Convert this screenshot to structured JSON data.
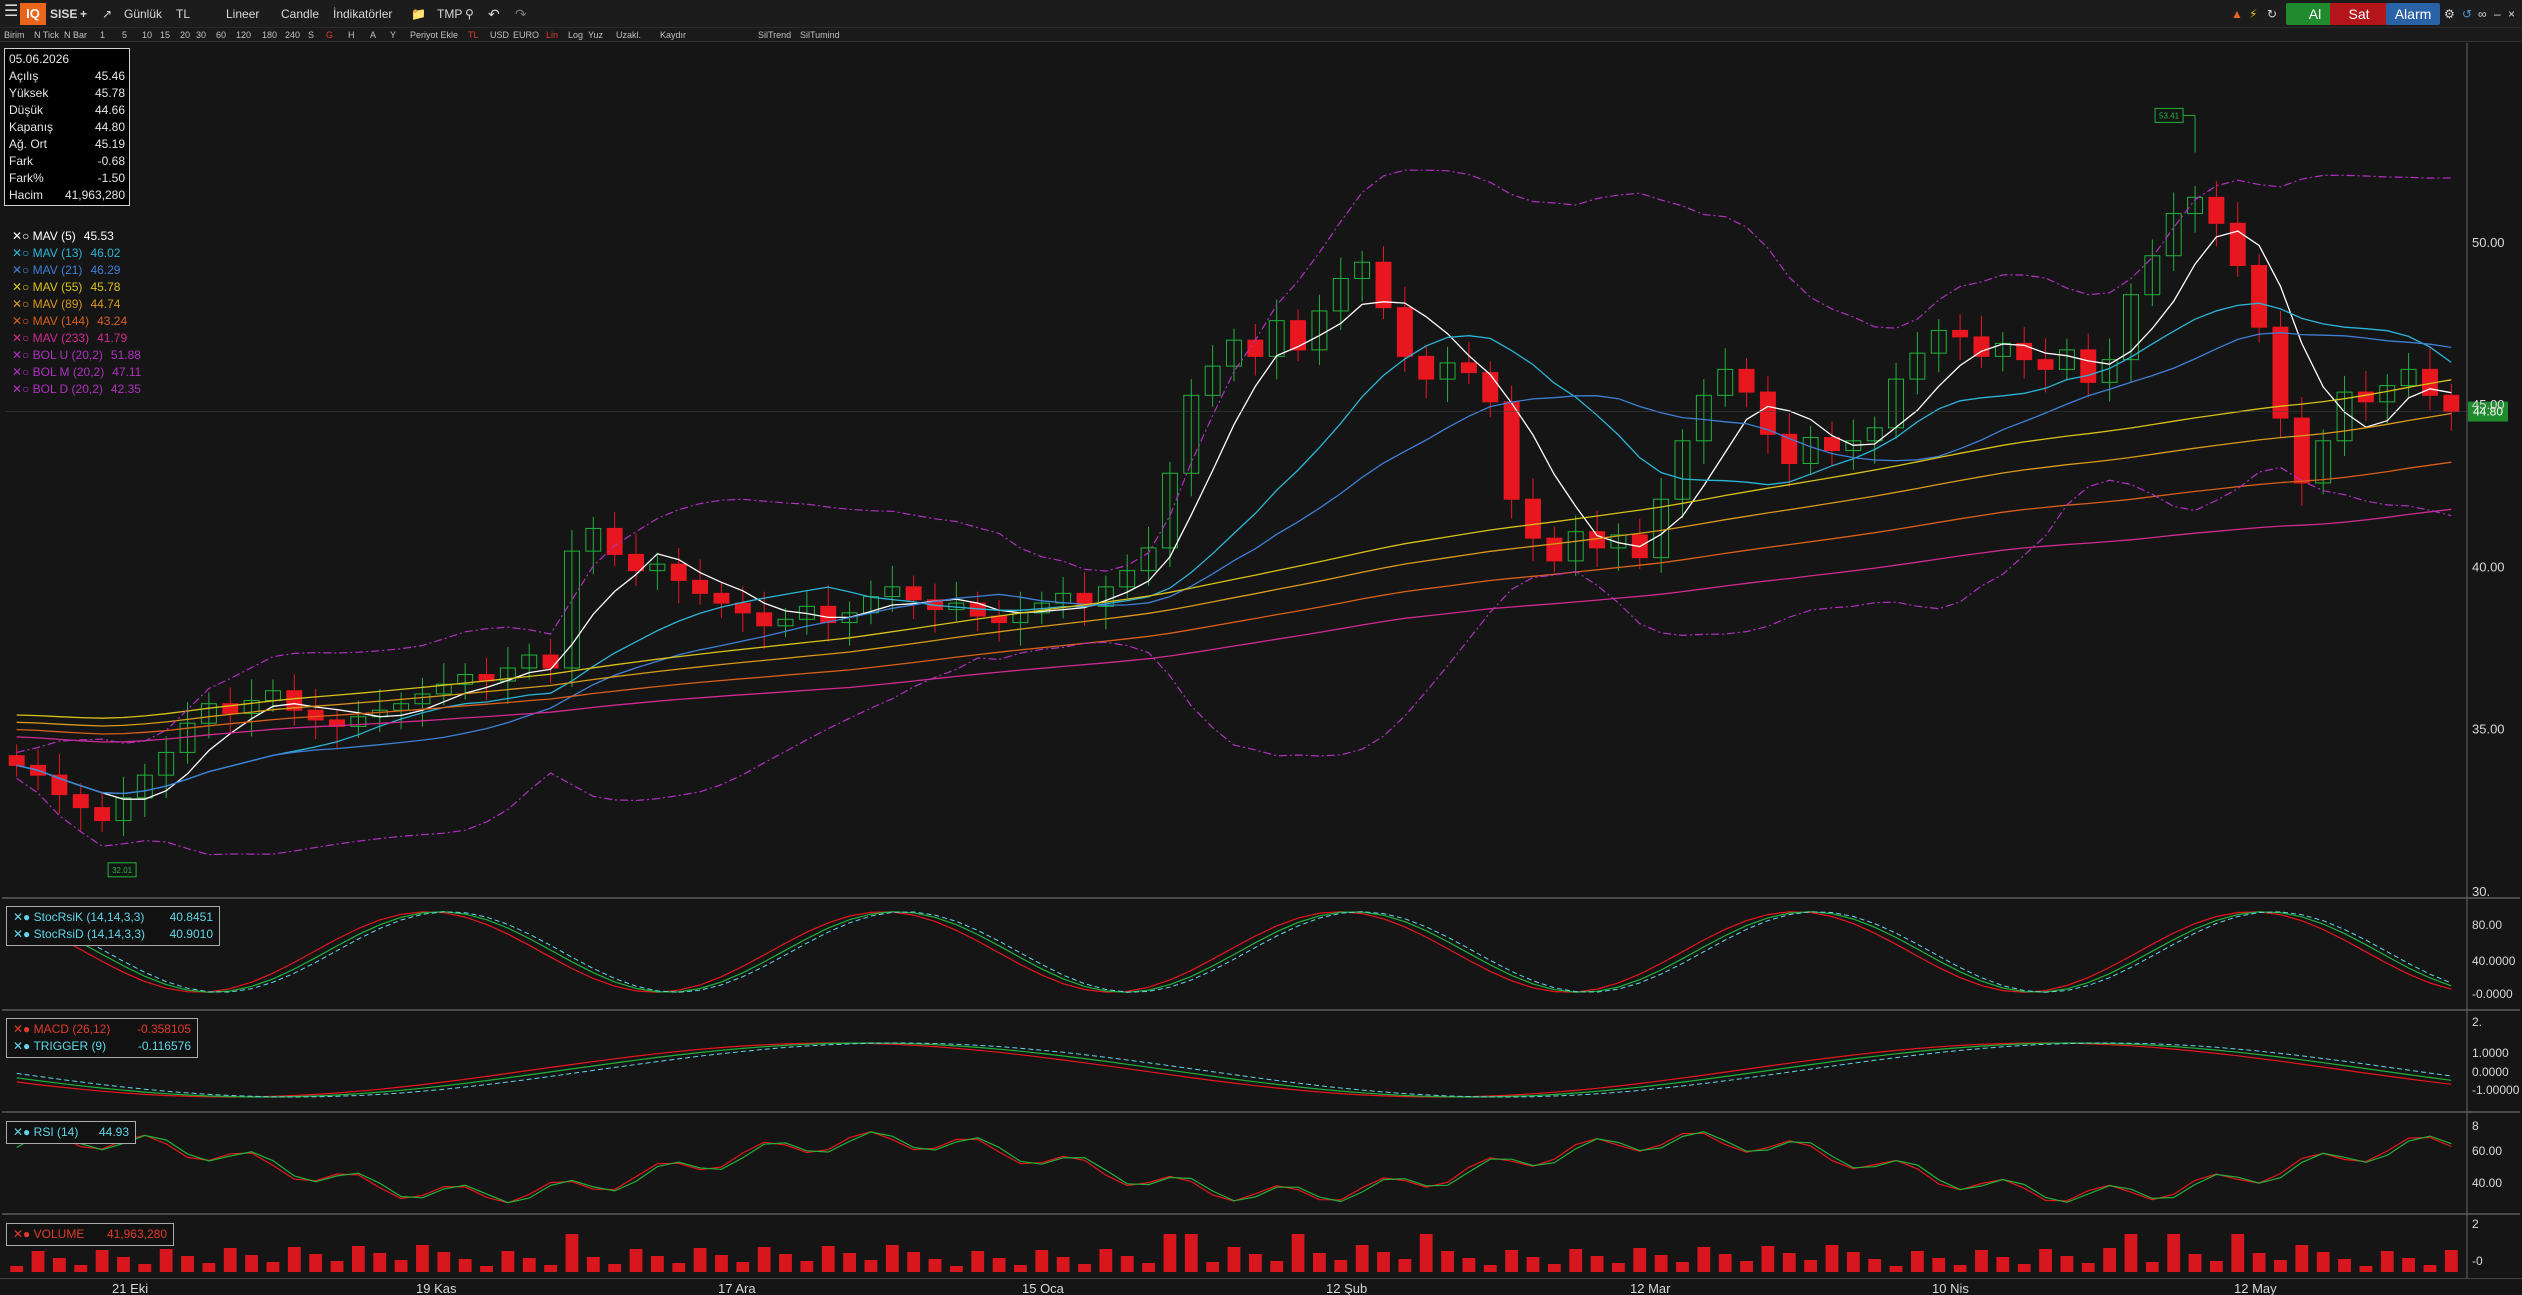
{
  "toolbar": {
    "logo": "IQ",
    "symbol": "SISE",
    "add": "+",
    "period": "Günlük",
    "currency": "TL",
    "scale": "Lineer",
    "chart_type": "Candle",
    "indicators": "İndikatörler",
    "tmp": "TMP",
    "buy": "Al",
    "sell": "Sat",
    "alarm": "Alarm"
  },
  "subbar": {
    "items": [
      "Birim",
      "N Tick",
      "N Bar",
      "1",
      "5",
      "10",
      "15",
      "20",
      "30",
      "60",
      "120",
      "180",
      "240",
      "S",
      "G",
      "H",
      "A",
      "Y",
      "Periyot Ekle",
      "TL",
      "USD",
      "EURO",
      "Lin",
      "Log",
      "Yuz",
      "Uzakl.",
      "Kaydır",
      "SilTrend",
      "SilTumind"
    ]
  },
  "info_box": {
    "date": "05.06.2026",
    "rows": [
      {
        "label": "Açılış",
        "value": "45.46"
      },
      {
        "label": "Yüksek",
        "value": "45.78"
      },
      {
        "label": "Düşük",
        "value": "44.66"
      },
      {
        "label": "Kapanış",
        "value": "44.80"
      },
      {
        "label": "Ağ. Ort",
        "value": "45.19"
      },
      {
        "label": "Fark",
        "value": "-0.68"
      },
      {
        "label": "Fark%",
        "value": "-1.50"
      },
      {
        "label": "Hacim",
        "value": "41,963,280"
      }
    ]
  },
  "legend": [
    {
      "label": "MAV (5)",
      "value": "45.53",
      "color": "#ffffff"
    },
    {
      "label": "MAV (13)",
      "value": "46.02",
      "color": "#2bb5d6"
    },
    {
      "label": "MAV (21)",
      "value": "46.29",
      "color": "#3f7fd6"
    },
    {
      "label": "MAV (55)",
      "value": "45.78",
      "color": "#d8c21a"
    },
    {
      "label": "MAV (89)",
      "value": "44.74",
      "color": "#d89a1a"
    },
    {
      "label": "MAV (144)",
      "value": "43.24",
      "color": "#d8601a"
    },
    {
      "label": "MAV (233)",
      "value": "41.79",
      "color": "#d02a90"
    },
    {
      "label": "BOL U (20,2)",
      "value": "51.88",
      "color": "#b030c0"
    },
    {
      "label": "BOL M (20,2)",
      "value": "47.11",
      "color": "#b030c0"
    },
    {
      "label": "BOL D (20,2)",
      "value": "42.35",
      "color": "#b030c0"
    }
  ],
  "price_axis": {
    "labels": [
      "50.00",
      "45.00",
      "40.00",
      "35.00",
      "30."
    ],
    "last_price": "44.80",
    "hi_marker": "53.41",
    "lo_marker": "32.01"
  },
  "stoch": {
    "k_label": "StocRsiK (14,14,3,3)",
    "k_value": "40.8451",
    "d_label": "StocRsiD (14,14,3,3)",
    "d_value": "40.9010",
    "axis": [
      "80.00",
      "40.0000",
      "-0.0000"
    ]
  },
  "macd": {
    "macd_label": "MACD (26,12)",
    "macd_value": "-0.358105",
    "trig_label": "TRIGGER (9)",
    "trig_value": "-0.116576",
    "axis": [
      "2.",
      "1.0000",
      "0.0000",
      "-1.00000"
    ]
  },
  "rsi": {
    "label": "RSI (14)",
    "value": "44.93",
    "axis": [
      "8",
      "60.00",
      "40.00"
    ]
  },
  "volume": {
    "label": "VOLUME",
    "value": "41,963,280",
    "axis": [
      "2",
      "-0"
    ]
  },
  "dates": [
    "21 Eki",
    "19 Kas",
    "17 Ara",
    "15 Oca",
    "12 Şub",
    "12 Mar",
    "10 Nis",
    "12 May"
  ],
  "chart_data": {
    "type": "candlestick",
    "symbol": "SISE",
    "ylim": [
      30,
      56
    ],
    "closes": [
      33.9,
      33.6,
      33.0,
      32.6,
      32.2,
      32.9,
      33.6,
      34.3,
      35.2,
      35.8,
      35.5,
      35.9,
      36.2,
      35.6,
      35.3,
      35.1,
      35.4,
      35.6,
      35.8,
      36.1,
      36.4,
      36.7,
      36.5,
      36.9,
      37.3,
      36.9,
      40.5,
      41.2,
      40.4,
      39.9,
      40.1,
      39.6,
      39.2,
      38.9,
      38.6,
      38.2,
      38.4,
      38.8,
      38.3,
      38.6,
      39.1,
      39.4,
      39.0,
      38.7,
      38.9,
      38.5,
      38.3,
      38.6,
      38.9,
      39.2,
      38.8,
      39.4,
      39.9,
      40.6,
      42.9,
      45.3,
      46.2,
      47.0,
      46.5,
      47.6,
      46.7,
      47.9,
      48.9,
      49.4,
      48.0,
      46.5,
      45.8,
      46.3,
      46.0,
      45.1,
      42.1,
      40.9,
      40.2,
      41.1,
      40.6,
      41.0,
      40.3,
      42.1,
      43.9,
      45.3,
      46.1,
      45.4,
      44.1,
      43.2,
      44.0,
      43.6,
      43.9,
      44.3,
      45.8,
      46.6,
      47.3,
      47.1,
      46.5,
      46.9,
      46.4,
      46.1,
      46.7,
      45.7,
      46.4,
      48.4,
      49.6,
      50.9,
      51.4,
      50.6,
      49.3,
      47.4,
      44.6,
      42.6,
      43.9,
      45.4,
      45.1,
      45.6,
      46.1,
      45.3,
      44.8
    ],
    "mav": [
      {
        "name": "MAV (5)",
        "value": 45.53
      },
      {
        "name": "MAV (13)",
        "value": 46.02
      },
      {
        "name": "MAV (21)",
        "value": 46.29
      },
      {
        "name": "MAV (55)",
        "value": 45.78
      },
      {
        "name": "MAV (89)",
        "value": 44.74
      },
      {
        "name": "MAV (144)",
        "value": 43.24
      },
      {
        "name": "MAV (233)",
        "value": 41.79
      }
    ],
    "bollinger": {
      "upper": 51.88,
      "middle": 47.11,
      "lower": 42.35
    }
  }
}
